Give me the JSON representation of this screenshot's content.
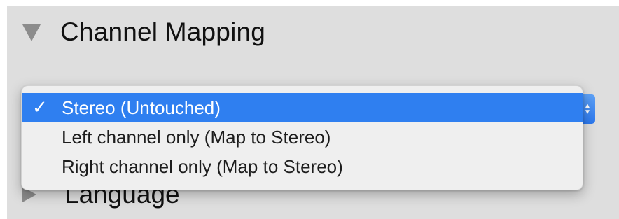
{
  "channel_mapping": {
    "title": "Channel Mapping",
    "expanded": true
  },
  "language": {
    "title": "Language",
    "expanded": false
  },
  "popup_menu": {
    "selected_index": 0,
    "checkmark_glyph": "✓",
    "accent_color": "#2f7ff0",
    "stepper_up_glyph": "▲",
    "stepper_down_glyph": "▼",
    "options": [
      {
        "label": "Stereo (Untouched)"
      },
      {
        "label": "Left channel only (Map to Stereo)"
      },
      {
        "label": "Right channel only (Map to Stereo)"
      }
    ]
  }
}
